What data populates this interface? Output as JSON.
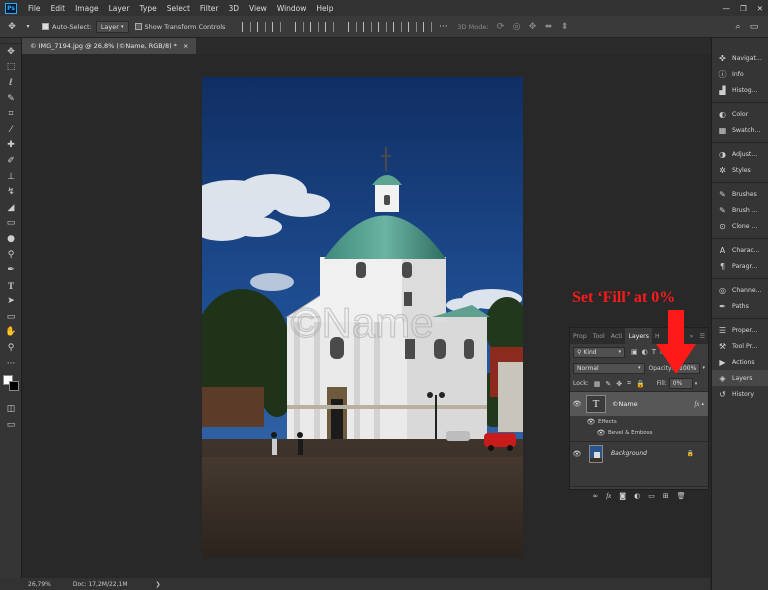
{
  "app": {
    "logo": "Ps"
  },
  "menu": [
    "File",
    "Edit",
    "Image",
    "Layer",
    "Type",
    "Select",
    "Filter",
    "3D",
    "View",
    "Window",
    "Help"
  ],
  "options": {
    "auto_select_label": "Auto-Select:",
    "auto_select_checked": true,
    "target_value": "Layer",
    "show_transform_label": "Show Transform Controls",
    "show_transform_checked": false,
    "mode_3d_label": "3D Mode:"
  },
  "document": {
    "tab_title": "© IMG_7194.jpg @ 26,8% (©Name, RGB/8) *",
    "close_glyph": "×"
  },
  "status": {
    "zoom": "26,79%",
    "doc_info": "Doc: 17,2M/22,1M",
    "arrow": "❯"
  },
  "watermark": {
    "text": "©Name"
  },
  "dock": {
    "items": [
      {
        "label": "Navigat...",
        "icon": "navigator-icon",
        "glyph": "✜"
      },
      {
        "label": "Info",
        "icon": "info-icon",
        "glyph": "ⓘ"
      },
      {
        "label": "Histog...",
        "icon": "histogram-icon",
        "glyph": "▟"
      },
      {
        "label": "Color",
        "icon": "color-icon",
        "glyph": "◐"
      },
      {
        "label": "Swatch...",
        "icon": "swatches-icon",
        "glyph": "▦"
      },
      {
        "label": "Adjust...",
        "icon": "adjustments-icon",
        "glyph": "◑"
      },
      {
        "label": "Styles",
        "icon": "styles-icon",
        "glyph": "✲"
      },
      {
        "label": "Brushes",
        "icon": "brushes-icon",
        "glyph": "✎"
      },
      {
        "label": "Brush ...",
        "icon": "brush-settings-icon",
        "glyph": "✎"
      },
      {
        "label": "Clone ...",
        "icon": "clone-source-icon",
        "glyph": "⊙"
      },
      {
        "label": "Charac...",
        "icon": "character-icon",
        "glyph": "A"
      },
      {
        "label": "Paragr...",
        "icon": "paragraph-icon",
        "glyph": "¶"
      },
      {
        "label": "Channe...",
        "icon": "channels-icon",
        "glyph": "◎"
      },
      {
        "label": "Paths",
        "icon": "paths-icon",
        "glyph": "✒"
      },
      {
        "label": "Proper...",
        "icon": "properties-icon",
        "glyph": "☰"
      },
      {
        "label": "Tool Pr...",
        "icon": "tool-presets-icon",
        "glyph": "⚒"
      },
      {
        "label": "Actions",
        "icon": "actions-icon",
        "glyph": "▶"
      },
      {
        "label": "Layers",
        "icon": "layers-icon",
        "glyph": "◈"
      },
      {
        "label": "History",
        "icon": "history-icon",
        "glyph": "↺"
      }
    ]
  },
  "layers_panel": {
    "tabs": [
      "Prop",
      "Tool",
      "Acti",
      "Layers",
      "H"
    ],
    "active_tab": "Layers",
    "more": "»",
    "kind_label": "Kind",
    "blend_mode": "Normal",
    "opacity_label": "Opacity:",
    "opacity_value": "100%",
    "lock_label": "Lock:",
    "fill_label": "Fill:",
    "fill_value": "0%",
    "layers": [
      {
        "name": "©Name",
        "type": "text",
        "thumb": "T",
        "fx": "fx",
        "selected": true
      },
      {
        "name": "Background",
        "type": "image",
        "locked": true
      }
    ],
    "effects_label": "Effects",
    "effect_items": [
      "Bevel & Emboss"
    ]
  },
  "annotation": {
    "text": "Set ‘Fill’ at 0%",
    "color": "#ff1a1a"
  }
}
